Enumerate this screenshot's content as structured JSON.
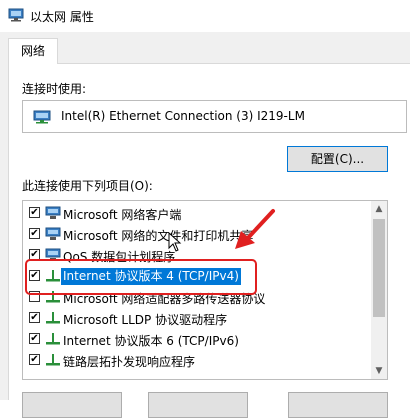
{
  "window": {
    "title": "以太网 属性"
  },
  "tabs": [
    {
      "label": "网络"
    }
  ],
  "connection": {
    "label": "连接时使用:",
    "adapter": "Intel(R) Ethernet Connection (3) I219-LM",
    "configure_label": "配置(C)..."
  },
  "items": {
    "label": "此连接使用下列项目(O):",
    "list": [
      {
        "text": "Microsoft 网络客户端",
        "checked": true,
        "icon": "network-client-icon"
      },
      {
        "text": "Microsoft 网络的文件和打印机共享",
        "checked": true,
        "icon": "network-client-icon"
      },
      {
        "text": "QoS 数据包计划程序",
        "checked": true,
        "icon": "network-client-icon"
      },
      {
        "text": "Internet 协议版本 4 (TCP/IPv4)",
        "checked": true,
        "selected": true,
        "icon": "protocol-icon"
      },
      {
        "text": "Microsoft 网络适配器多路传送器协议",
        "checked": false,
        "icon": "protocol-icon"
      },
      {
        "text": "Microsoft LLDP 协议驱动程序",
        "checked": true,
        "icon": "protocol-icon"
      },
      {
        "text": "Internet 协议版本 6 (TCP/IPv6)",
        "checked": true,
        "icon": "protocol-icon"
      },
      {
        "text": "链路层拓扑发现响应程序",
        "checked": true,
        "icon": "protocol-icon"
      }
    ]
  },
  "colors": {
    "selection": "#0078d7",
    "annotation": "#e02020",
    "protocol_icon": "#2a8f3a",
    "network_icon": "#3a7fc4"
  }
}
